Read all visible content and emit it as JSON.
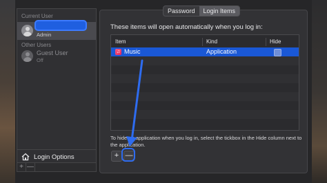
{
  "sidebar": {
    "current_user_label": "Current User",
    "current_user": {
      "name": "",
      "role": "Admin"
    },
    "other_users_label": "Other Users",
    "guest_user": {
      "name": "Guest User",
      "status": "Off"
    },
    "login_options_label": "Login Options",
    "tools": [
      "+",
      "—"
    ]
  },
  "tabs": [
    {
      "label": "Password",
      "active": false
    },
    {
      "label": "Login Items",
      "active": true
    }
  ],
  "main": {
    "intro_text": "These items will open automatically when you log in:",
    "table": {
      "columns": [
        "Item",
        "Kind",
        "Hide"
      ],
      "rows": [
        {
          "item": "Music",
          "kind": "Application",
          "hide": false,
          "selected": true
        }
      ]
    },
    "help_text": "To hide an application when you log in, select the tickbox in the Hide column next to the application.",
    "add_button": "+",
    "remove_button": "—"
  },
  "colors": {
    "selection": "#1a58d6",
    "annotation": "#2e6cf0"
  }
}
